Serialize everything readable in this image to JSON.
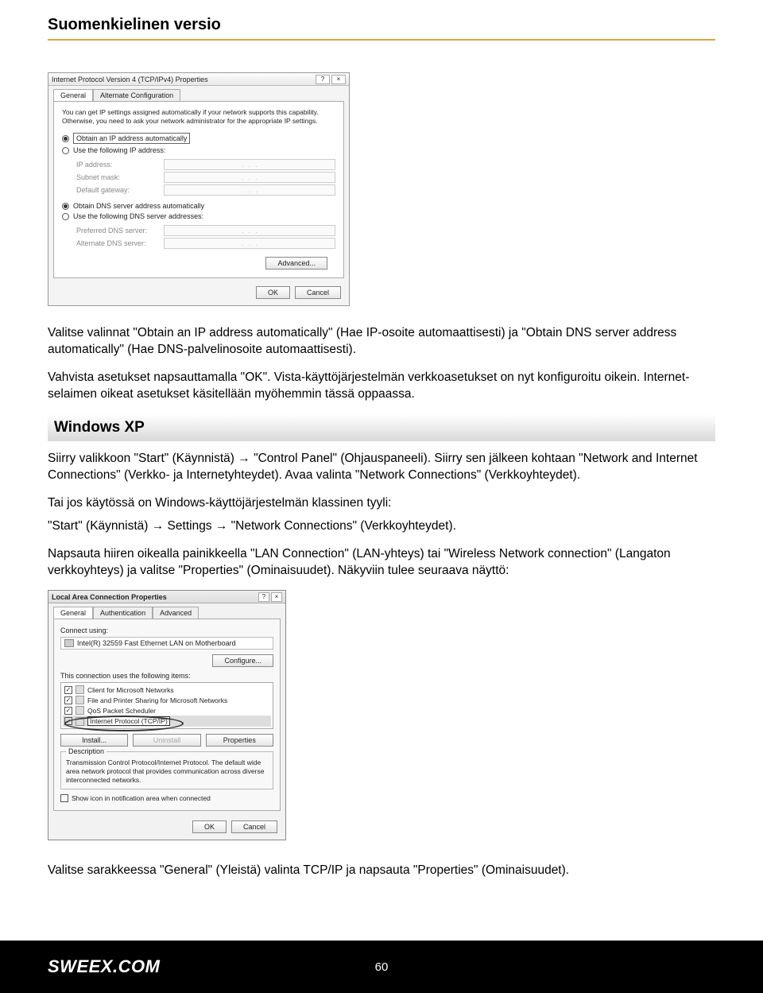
{
  "header": {
    "title": "Suomenkielinen versio"
  },
  "dialog1": {
    "title": "Internet Protocol Version 4 (TCP/IPv4) Properties",
    "tabs": {
      "general": "General",
      "alternate": "Alternate Configuration"
    },
    "explain": "You can get IP settings assigned automatically if your network supports this capability. Otherwise, you need to ask your network administrator for the appropriate IP settings.",
    "radios": {
      "obtain_ip": "Obtain an IP address automatically",
      "use_ip": "Use the following IP address:",
      "obtain_dns": "Obtain DNS server address automatically",
      "use_dns": "Use the following DNS server addresses:"
    },
    "fields": {
      "ip": "IP address:",
      "subnet": "Subnet mask:",
      "gateway": "Default gateway:",
      "pref_dns": "Preferred DNS server:",
      "alt_dns": "Alternate DNS server:"
    },
    "buttons": {
      "advanced": "Advanced...",
      "ok": "OK",
      "cancel": "Cancel"
    }
  },
  "body": {
    "p1": "Valitse valinnat \"Obtain an IP address automatically\" (Hae IP-osoite automaattisesti) ja \"Obtain DNS server address automatically\" (Hae DNS-palvelinosoite automaattisesti).",
    "p2": "Vahvista asetukset napsauttamalla \"OK\". Vista-käyttöjärjestelmän verkkoasetukset on nyt konfiguroitu oikein. Internet-selaimen oikeat asetukset käsitellään myöhemmin tässä oppaassa.",
    "section": "Windows XP",
    "p3a": "Siirry valikkoon \"Start\" (Käynnistä) ",
    "p3b": " \"Control Panel\" (Ohjauspaneeli). Siirry sen jälkeen kohtaan \"Network and Internet Connections\" (Verkko- ja Internetyhteydet). Avaa valinta \"Network Connections\" (Verkkoyhteydet).",
    "p4": "Tai jos käytössä on Windows-käyttöjärjestelmän klassinen tyyli:",
    "p5a": "\"Start\" (Käynnistä) ",
    "p5b": " Settings ",
    "p5c": " \"Network Connections\" (Verkkoyhteydet).",
    "p6": "Napsauta hiiren oikealla painikkeella \"LAN Connection\" (LAN-yhteys) tai \"Wireless Network connection\" (Langaton verkkoyhteys) ja valitse \"Properties\" (Ominaisuudet). Näkyviin tulee seuraava näyttö:",
    "p7": "Valitse sarakkeessa \"General\" (Yleistä) valinta TCP/IP ja napsauta \"Properties\" (Ominaisuudet).",
    "arrow": "→"
  },
  "dialog2": {
    "title": "Local Area Connection Properties",
    "tabs": {
      "general": "General",
      "auth": "Authentication",
      "adv": "Advanced"
    },
    "connect_using": "Connect using:",
    "device": "Intel(R) 32559 Fast Ethernet LAN on Motherboard",
    "configure": "Configure...",
    "items_label": "This connection uses the following items:",
    "items": {
      "client": "Client for Microsoft Networks",
      "fileprint": "File and Printer Sharing for Microsoft Networks",
      "qos": "QoS Packet Scheduler",
      "tcpip": "Internet Protocol (TCP/IP)"
    },
    "buttons": {
      "install": "Install...",
      "uninstall": "Uninstall",
      "properties": "Properties",
      "ok": "OK",
      "cancel": "Cancel"
    },
    "desc_title": "Description",
    "desc": "Transmission Control Protocol/Internet Protocol. The default wide area network protocol that provides communication across diverse interconnected networks.",
    "notify": "Show icon in notification area when connected"
  },
  "footer": {
    "brand": "SWEEX.COM",
    "page": "60"
  }
}
